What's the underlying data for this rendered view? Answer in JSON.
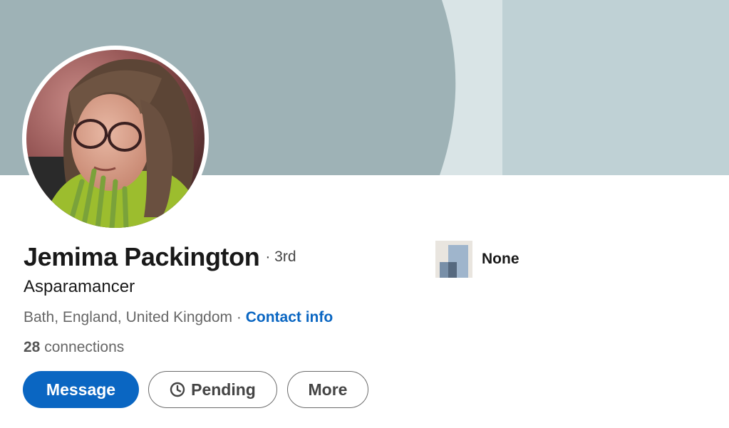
{
  "profile": {
    "name": "Jemima Packington",
    "degree": "· 3rd",
    "headline": "Asparamancer",
    "location": "Bath, England, United Kingdom",
    "separator": " · ",
    "contact_info_label": "Contact info",
    "connections_count": "28",
    "connections_label": " connections"
  },
  "actions": {
    "message_label": "Message",
    "pending_label": "Pending",
    "more_label": "More",
    "pending_icon": "clock-icon"
  },
  "company": {
    "name": "None",
    "logo_icon": "company-placeholder-logo"
  },
  "colors": {
    "primary": "#0a66c2",
    "banner_dark": "#9eb2b6",
    "banner_light": "#bfd1d5",
    "banner_stripe": "#d9e4e6",
    "text_primary": "#191919",
    "text_secondary": "#666666"
  }
}
